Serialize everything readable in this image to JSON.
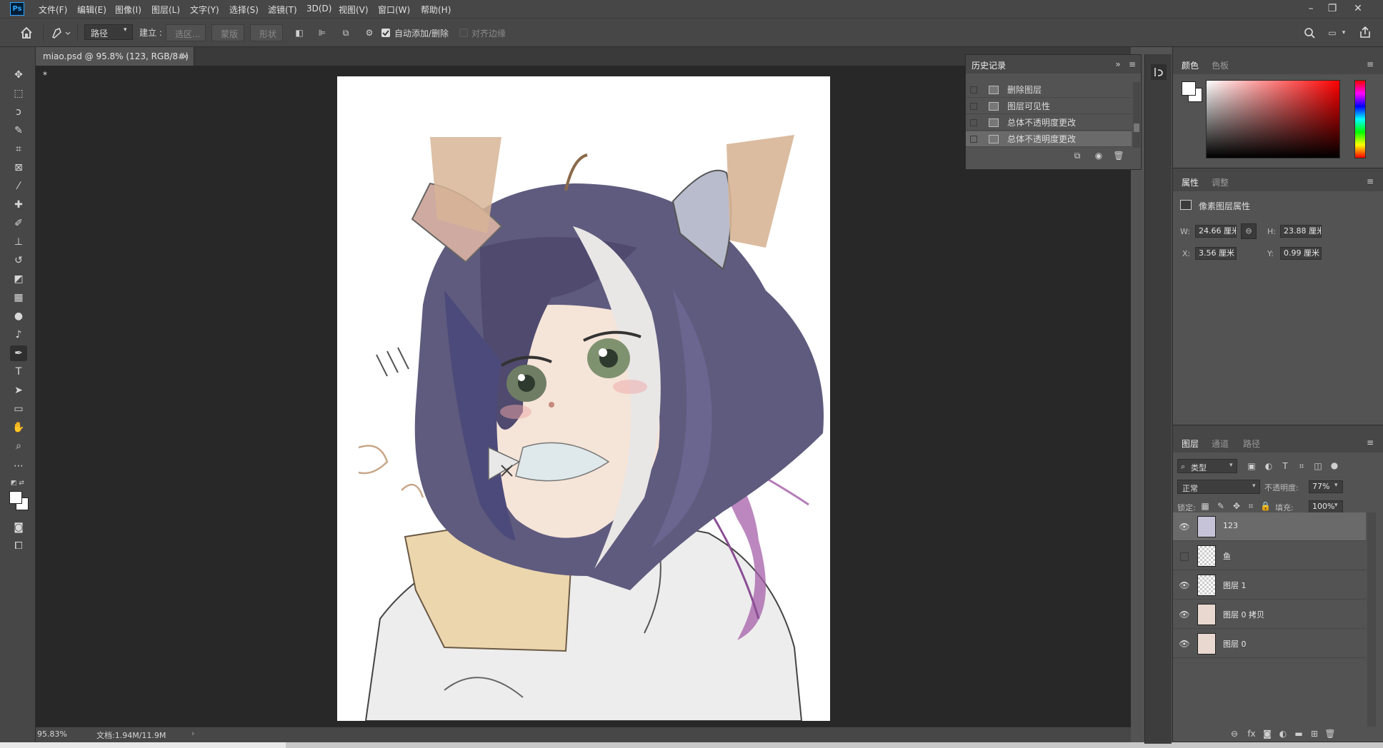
{
  "app": {
    "logo_text": "Ps"
  },
  "menubar": {
    "items": [
      "文件(F)",
      "编辑(E)",
      "图像(I)",
      "图层(L)",
      "文字(Y)",
      "选择(S)",
      "滤镜(T)",
      "3D(D)",
      "视图(V)",
      "窗口(W)",
      "帮助(H)"
    ]
  },
  "window_controls": {
    "minimize": "–",
    "restore": "❐",
    "close": "✕"
  },
  "options": {
    "mode_value": "路径",
    "make_label": "建立 :",
    "selection_btn": "选区...",
    "mask_btn": "蒙版",
    "shape_btn": "形状",
    "auto_add_delete": "自动添加/删除",
    "align_edges": "对齐边缘"
  },
  "document": {
    "tab_title": "miao.psd @ 95.8% (123, RGB/8#) *",
    "tab_close": "×"
  },
  "status": {
    "zoom": "95.83%",
    "doc_size": "文档:1.94M/11.9M",
    "arrow": "›"
  },
  "history": {
    "tab": "历史记录",
    "items": [
      {
        "label": "删除图层",
        "selected": false
      },
      {
        "label": "图层可见性",
        "selected": false
      },
      {
        "label": "总体不透明度更改",
        "selected": false
      },
      {
        "label": "总体不透明度更改",
        "selected": true
      }
    ]
  },
  "color_panel": {
    "tabs": [
      "颜色",
      "色板"
    ],
    "foreground": "#ffffff",
    "background": "#ffffff",
    "hue": "#ff0000"
  },
  "properties_panel": {
    "tabs": [
      "属性",
      "调整"
    ],
    "section_title": "像素图层属性",
    "w_label": "W:",
    "w_value": "24.66 厘米",
    "h_label": "H:",
    "h_value": "23.88 厘米",
    "x_label": "X:",
    "x_value": "3.56 厘米",
    "y_label": "Y:",
    "y_value": "0.99 厘米"
  },
  "layers_panel": {
    "tabs": [
      "图层",
      "通道",
      "路径"
    ],
    "filter_kind": "类型",
    "blend_mode": "正常",
    "opacity_label": "不透明度:",
    "opacity_value": "77%",
    "lock_label": "锁定:",
    "fill_label": "填充:",
    "fill_value": "100%",
    "layers": [
      {
        "name": "123",
        "visible": true,
        "selected": true
      },
      {
        "name": "鱼",
        "visible": false,
        "selected": false
      },
      {
        "name": "图层 1",
        "visible": true,
        "selected": false
      },
      {
        "name": "图层 0 拷贝",
        "visible": true,
        "selected": false
      },
      {
        "name": "图层 0",
        "visible": true,
        "selected": false
      }
    ]
  }
}
